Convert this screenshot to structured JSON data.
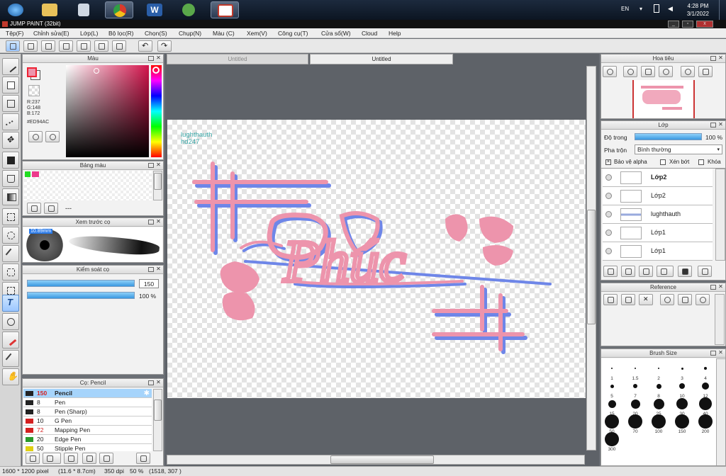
{
  "taskbar": {
    "lang": "EN",
    "time": "4:28 PM",
    "date": "3/1/2022",
    "apps": [
      {
        "icon": "start-orb-icon",
        "color": "#3a8fd8"
      },
      {
        "icon": "explorer-folder-icon",
        "color": "#e8c15a"
      },
      {
        "icon": "calculator-icon",
        "color": "#cfd8e3"
      },
      {
        "icon": "chrome-icon",
        "color": "#d93a2b"
      },
      {
        "icon": "word-icon",
        "color": "#2a5ea8"
      },
      {
        "icon": "paint-app-icon",
        "color": "#5aa84a"
      },
      {
        "icon": "jump-paint-icon",
        "color": "#c0392b"
      }
    ]
  },
  "window": {
    "title": "JUMP PAINT (32bit)"
  },
  "menu": [
    "Tệp(F)",
    "Chỉnh sửa(E)",
    "Lớp(L)",
    "Bộ lọc(R)",
    "Chọn(S)",
    "Chụp(N)",
    "Màu (C)",
    "Xem(V)",
    "Công cụ(T)",
    "Cửa sổ(W)",
    "Cloud",
    "Help"
  ],
  "panels": {
    "color": {
      "title": "Màu",
      "r": "R:237",
      "g": "G:148",
      "b": "B:172",
      "hex": "#ED94AC",
      "main_color": "#ed94ac",
      "hue_color": "#d4144c"
    },
    "palette": {
      "title": "Bảng màu",
      "extra": "---",
      "swatches": [
        "#22dd22",
        "#ed3a8c"
      ]
    },
    "brush_preview": {
      "title": "Xem trước cọ",
      "size": "10.89mm"
    },
    "brush_control": {
      "title": "Kiểm soát cọ",
      "size_value": "150",
      "opacity_value": "100 %"
    },
    "brush_list": {
      "title": "Cọ: Pencil",
      "items": [
        {
          "color": "#222222",
          "size": "150",
          "name": "Pencil",
          "size_red": true,
          "selected": true
        },
        {
          "color": "#222222",
          "size": "8",
          "name": "Pen",
          "size_red": false,
          "selected": false
        },
        {
          "color": "#222222",
          "size": "8",
          "name": "Pen (Sharp)",
          "size_red": false,
          "selected": false
        },
        {
          "color": "#d42020",
          "size": "10",
          "name": "G Pen",
          "size_red": false,
          "selected": false
        },
        {
          "color": "#d42020",
          "size": "72",
          "name": "Mapping Pen",
          "size_red": true,
          "selected": false
        },
        {
          "color": "#2a9a2a",
          "size": "20",
          "name": "Edge Pen",
          "size_red": false,
          "selected": false
        },
        {
          "color": "#e0d010",
          "size": "50",
          "name": "Stipple Pen",
          "size_red": false,
          "selected": false
        }
      ]
    },
    "navigator": {
      "title": "Hoa tiêu"
    },
    "layers": {
      "title": "Lớp",
      "opacity_label": "Độ trong",
      "opacity_value": "100 %",
      "blend_label": "Pha trộn",
      "blend_value": "Bình thường",
      "protect_alpha": "Bảo vệ alpha",
      "clipping": "Xén bớt",
      "lock": "Khóa",
      "items": [
        {
          "name": "Lớp2",
          "selected": true
        },
        {
          "name": "Lớp2",
          "selected": false
        },
        {
          "name": "lughthauth",
          "selected": false
        },
        {
          "name": "Lớp1",
          "selected": false
        },
        {
          "name": "Lớp1",
          "selected": false
        }
      ]
    },
    "reference": {
      "title": "Reference"
    },
    "brush_size": {
      "title": "Brush Size",
      "sizes": [
        "1",
        "1.5",
        "2",
        "3",
        "4",
        "5",
        "7",
        "8",
        "10",
        "12",
        "15",
        "20",
        "25",
        "30",
        "40",
        "50",
        "70",
        "100",
        "150",
        "200",
        "300"
      ]
    }
  },
  "document": {
    "tabs": [
      "Untitled",
      "Untitled"
    ],
    "active_tab": 1,
    "watermark_line1": "lughthauth",
    "watermark_line2": "hd247",
    "artwork_text": "Phúc",
    "artwork_colors": {
      "pink": "#ed94ac",
      "blue": "#6e86e8"
    }
  },
  "status": {
    "pixels": "1600 * 1200 pixel",
    "cm": "(11.6 * 8.7cm)",
    "dpi": "350 dpi",
    "zoom": "50 %",
    "cursor": "(1518, 307 )"
  }
}
